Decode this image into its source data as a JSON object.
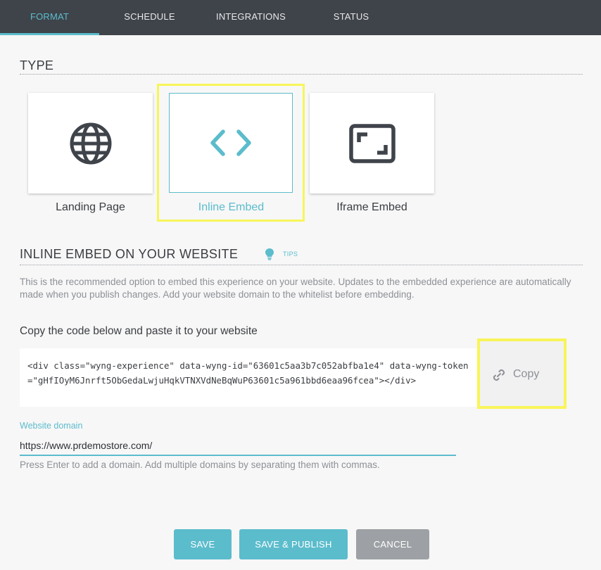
{
  "tabs": [
    {
      "label": "FORMAT",
      "active": true
    },
    {
      "label": "SCHEDULE",
      "active": false
    },
    {
      "label": "INTEGRATIONS",
      "active": false
    },
    {
      "label": "STATUS",
      "active": false
    }
  ],
  "type_section": {
    "title": "TYPE",
    "options": [
      {
        "label": "Landing Page",
        "icon": "globe-icon",
        "selected": false
      },
      {
        "label": "Inline Embed",
        "icon": "code-brackets-icon",
        "selected": true
      },
      {
        "label": "Iframe Embed",
        "icon": "frame-icon",
        "selected": false
      }
    ]
  },
  "embed_section": {
    "title": "INLINE EMBED ON YOUR WEBSITE",
    "tips_label": "TIPS",
    "description": "This is the recommended option to embed this experience on your website. Updates to the embedded experience are automatically made when you publish changes. Add your website domain to the whitelist before embedding.",
    "copy_heading": "Copy the code below and paste it to your website",
    "code": "<div class=\"wyng-experience\" data-wyng-id=\"63601c5aa3b7c052abfba1e4\" data-wyng-token=\"gHfIOyM6Jnrft5ObGedaLwjuHqkVTNXVdNeBqWuP63601c5a961bbd6eaa96fcea\"></div>",
    "copy_label": "Copy",
    "domain_label": "Website domain",
    "domain_value": "https://www.prdemostore.com/",
    "domain_hint": "Press Enter to add a domain. Add multiple domains by separating them with commas."
  },
  "actions": {
    "save": "SAVE",
    "save_publish": "SAVE & PUBLISH",
    "cancel": "CANCEL"
  },
  "colors": {
    "accent": "#5bbccc",
    "tabbar": "#3f434a",
    "highlight": "#f8f55a",
    "cancel": "#9da0a4"
  }
}
